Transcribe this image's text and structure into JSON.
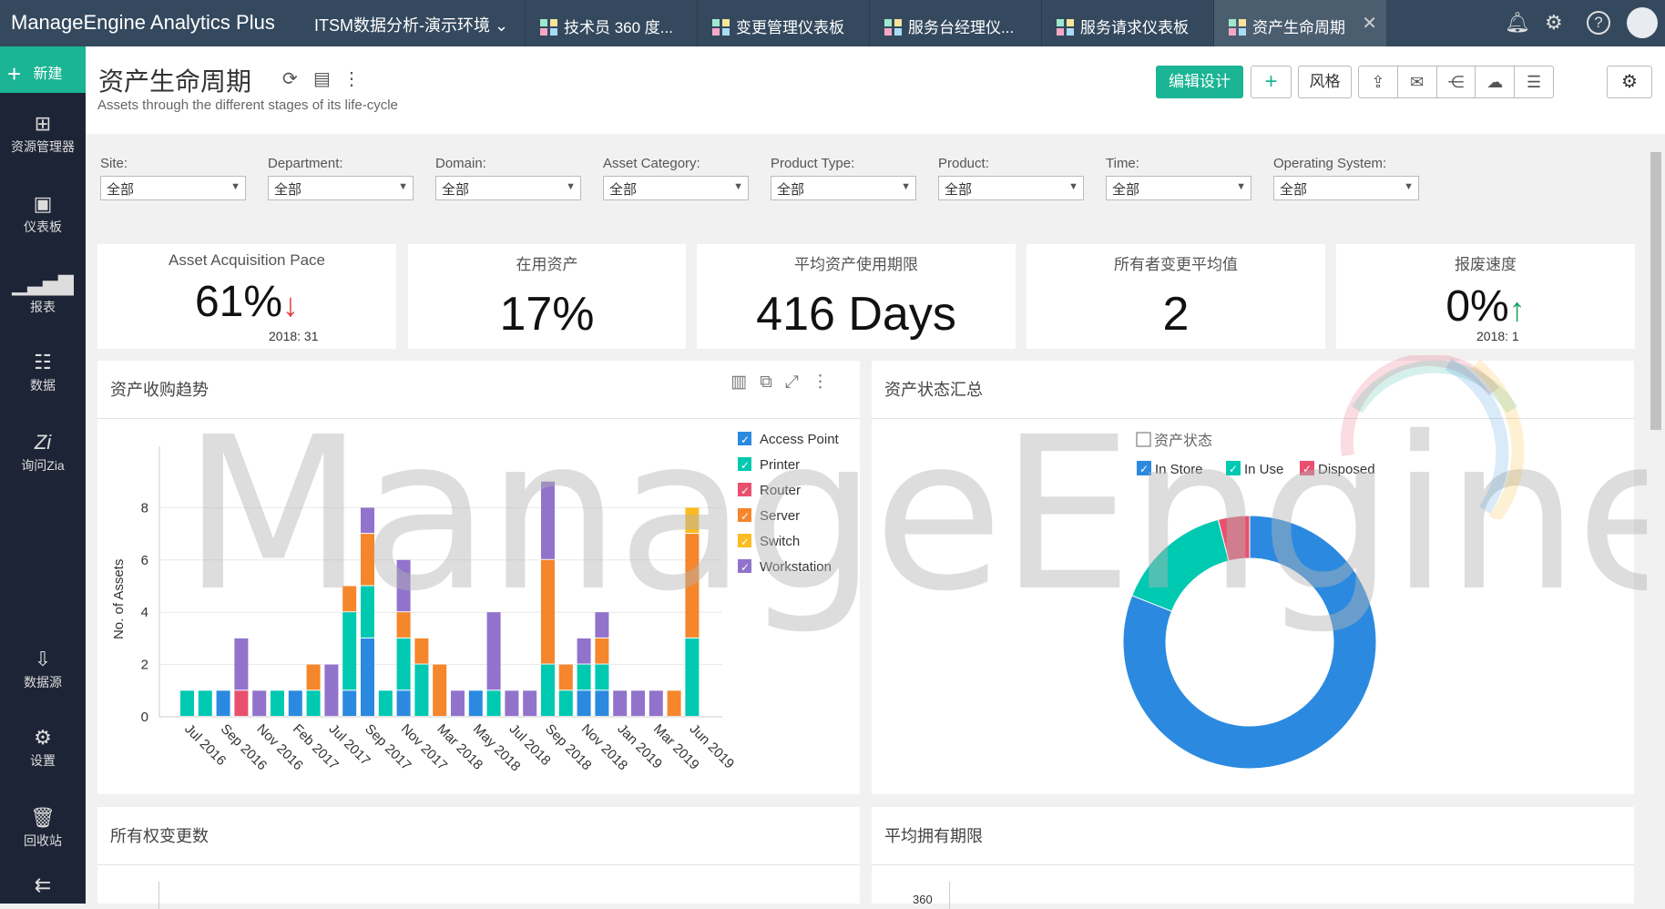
{
  "topbar": {
    "logo": "ManageEngine Analytics Plus",
    "workspace": "ITSM数据分析-演示环境",
    "tabs": [
      {
        "label": "技术员 360 度..."
      },
      {
        "label": "变更管理仪表板"
      },
      {
        "label": "服务台经理仪..."
      },
      {
        "label": "服务请求仪表板"
      },
      {
        "label": "资产生命周期",
        "active": true
      }
    ],
    "icons": [
      "bell-icon",
      "gear-icon",
      "help-icon",
      "avatar"
    ]
  },
  "sidebar": {
    "new_label": "新建",
    "items": [
      {
        "label": "资源管理器",
        "icon": "explorer-icon"
      },
      {
        "label": "仪表板",
        "icon": "dashboard-icon"
      },
      {
        "label": "报表",
        "icon": "reports-icon"
      },
      {
        "label": "数据",
        "icon": "table-icon"
      },
      {
        "label": "询问Zia",
        "icon": "zia-icon"
      },
      {
        "label": "数据源",
        "icon": "datasource-icon"
      },
      {
        "label": "设置",
        "icon": "gear-icon"
      },
      {
        "label": "回收站",
        "icon": "trash-icon"
      }
    ]
  },
  "header": {
    "title": "资产生命周期",
    "subtitle": "Assets through the different stages of its life-cycle",
    "edit_label": "编辑设计",
    "add_label": "+",
    "style_label": "风格"
  },
  "filters": [
    {
      "label": "Site:",
      "value": "全部"
    },
    {
      "label": "Department:",
      "value": "全部"
    },
    {
      "label": "Domain:",
      "value": "全部"
    },
    {
      "label": "Asset Category:",
      "value": "全部"
    },
    {
      "label": "Product Type:",
      "value": "全部"
    },
    {
      "label": "Product:",
      "value": "全部"
    },
    {
      "label": "Time:",
      "value": "全部"
    },
    {
      "label": "Operating System:",
      "value": "全部"
    }
  ],
  "kpis": [
    {
      "title": "Asset Acquisition Pace",
      "value": "61%",
      "arrow": "↓",
      "sub": "2018: 31",
      "arrow_color": "#e84040"
    },
    {
      "title": "在用资产",
      "value": "17%"
    },
    {
      "title": "平均资产使用期限",
      "value": "416 Days"
    },
    {
      "title": "所有者变更平均值",
      "value": "2"
    },
    {
      "title": "报废速度",
      "value": "0%",
      "arrow": "↑",
      "sub": "2018: 1",
      "arrow_color": "#1aa260"
    }
  ],
  "watermark": "ManageEngine",
  "chart_data": [
    {
      "type": "bar",
      "stacked": true,
      "title": "资产收购趋势",
      "ylabel": "No. of Assets",
      "ylim": [
        0,
        10
      ],
      "yticks": [
        0,
        2,
        4,
        6,
        8
      ],
      "grid": true,
      "legend": "right",
      "categories": [
        "Jul 2016",
        "",
        "Sep 2016",
        "",
        "Nov 2016",
        "",
        "Feb 2017",
        "",
        "Jul 2017",
        "",
        "Sep 2017",
        "",
        "Nov 2017",
        "",
        "Mar 2018",
        "",
        "May 2018",
        "",
        "Jul 2018",
        "",
        "Sep 2018",
        "",
        "Nov 2018",
        "",
        "Jan 2019",
        "",
        "Mar 2019",
        "",
        "Jun 2019"
      ],
      "series": [
        {
          "name": "Access Point",
          "color": "#2b8ae0",
          "values": [
            0,
            0,
            1,
            0,
            0,
            0,
            1,
            0,
            0,
            1,
            3,
            0,
            1,
            0,
            0,
            0,
            1,
            0,
            0,
            0,
            0,
            0,
            1,
            1,
            0,
            0,
            0,
            0,
            0
          ]
        },
        {
          "name": "Printer",
          "color": "#00c9b1",
          "values": [
            1,
            1,
            0,
            0,
            0,
            1,
            0,
            1,
            0,
            3,
            2,
            1,
            2,
            2,
            0,
            0,
            0,
            1,
            0,
            0,
            2,
            1,
            1,
            1,
            0,
            0,
            0,
            0,
            3
          ]
        },
        {
          "name": "Router",
          "color": "#e8506e",
          "values": [
            0,
            0,
            0,
            1,
            0,
            0,
            0,
            0,
            0,
            0,
            0,
            0,
            0,
            0,
            0,
            0,
            0,
            0,
            0,
            0,
            0,
            0,
            0,
            0,
            0,
            0,
            0,
            0,
            0
          ]
        },
        {
          "name": "Server",
          "color": "#f5862b",
          "values": [
            0,
            0,
            0,
            0,
            0,
            0,
            0,
            1,
            0,
            1,
            2,
            0,
            1,
            1,
            2,
            0,
            0,
            0,
            0,
            0,
            4,
            1,
            0,
            1,
            0,
            0,
            0,
            1,
            4
          ]
        },
        {
          "name": "Switch",
          "color": "#fbbb21",
          "values": [
            0,
            0,
            0,
            0,
            0,
            0,
            0,
            0,
            0,
            0,
            0,
            0,
            0,
            0,
            0,
            0,
            0,
            0,
            0,
            0,
            0,
            0,
            0,
            0,
            0,
            0,
            0,
            0,
            1
          ]
        },
        {
          "name": "Workstation",
          "color": "#9173cc",
          "values": [
            0,
            0,
            0,
            2,
            1,
            0,
            0,
            0,
            2,
            0,
            1,
            0,
            2,
            0,
            0,
            1,
            0,
            3,
            1,
            1,
            3,
            0,
            1,
            1,
            1,
            1,
            1,
            0,
            0
          ]
        }
      ]
    },
    {
      "type": "pie",
      "donut": true,
      "title": "资产状态汇总",
      "legend_title": "资产状态",
      "legend": "top",
      "slices": [
        {
          "name": "In Store",
          "value": 81,
          "color": "#2b8ae0"
        },
        {
          "name": "In Use",
          "value": 15,
          "color": "#00c9b1"
        },
        {
          "name": "Disposed",
          "value": 4,
          "color": "#e8506e"
        }
      ]
    }
  ],
  "bottom_panels": [
    {
      "title": "所有权变更数"
    },
    {
      "title": "平均拥有期限",
      "ytick": "360"
    }
  ]
}
